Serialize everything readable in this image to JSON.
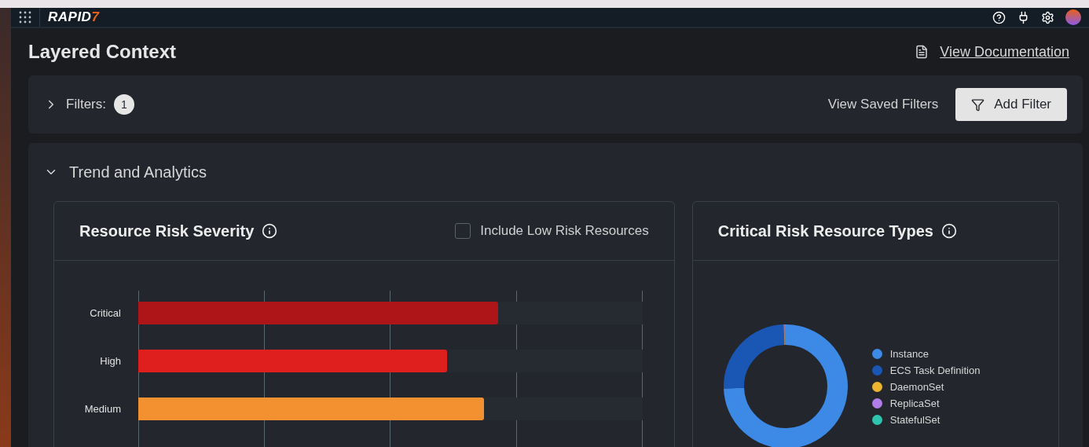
{
  "topbar": {
    "logo": "RAPID",
    "logo_mark": "7"
  },
  "header": {
    "title": "Layered Context",
    "doc_link": "View Documentation"
  },
  "filters": {
    "label": "Filters:",
    "count": "1",
    "expanded": false,
    "saved_link": "View Saved Filters",
    "add_button": "Add Filter"
  },
  "trend": {
    "title": "Trend and Analytics",
    "expanded": true
  },
  "severity_card": {
    "title": "Resource Risk Severity",
    "checkbox": {
      "label": "Include Low Risk Resources",
      "checked": false
    },
    "bars": [
      {
        "label": "Critical",
        "level": 0.714,
        "color": "#ad1519"
      },
      {
        "label": "High",
        "level": 0.613,
        "color": "#df1f1d"
      },
      {
        "label": "Medium",
        "level": 0.686,
        "color": "#f3902f"
      }
    ]
  },
  "types_card": {
    "title": "Critical Risk Resource Types",
    "legend": [
      {
        "label": "Instance",
        "color": "#3c8ae6"
      },
      {
        "label": "ECS Task Definition",
        "color": "#1a56b4"
      },
      {
        "label": "DaemonSet",
        "color": "#ecb42f"
      },
      {
        "label": "ReplicaSet",
        "color": "#b07ee6"
      },
      {
        "label": "StatefulSet",
        "color": "#2ec4b0"
      }
    ]
  }
}
